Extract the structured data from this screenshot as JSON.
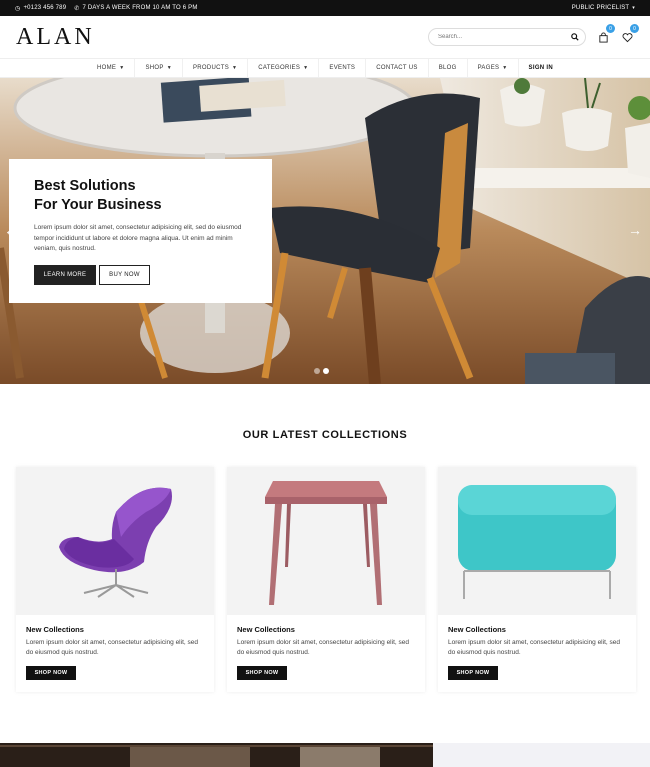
{
  "topbar": {
    "phone": "+0123 456 789",
    "hours": "7 DAYS A WEEK FROM 10 AM TO 6 PM",
    "pricelist": "PUBLIC PRICELIST"
  },
  "header": {
    "logo": "ALAN",
    "search_placeholder": "Search...",
    "cart_count": "0",
    "wishlist_count": "0"
  },
  "nav": {
    "items": [
      {
        "label": "HOME",
        "dropdown": true
      },
      {
        "label": "SHOP",
        "dropdown": true
      },
      {
        "label": "PRODUCTS",
        "dropdown": true
      },
      {
        "label": "CATEGORIES",
        "dropdown": true
      },
      {
        "label": "EVENTS",
        "dropdown": false
      },
      {
        "label": "CONTACT US",
        "dropdown": false
      },
      {
        "label": "BLOG",
        "dropdown": false
      },
      {
        "label": "PAGES",
        "dropdown": true
      },
      {
        "label": "SIGN IN",
        "dropdown": false
      }
    ]
  },
  "hero": {
    "title_line1": "Best Solutions",
    "title_line2": "For Your Business",
    "text": "Lorem ipsum dolor sit amet, consectetur adipisicing elit, sed do eiusmod tempor incididunt ut labore et dolore magna aliqua. Ut enim ad minim veniam, quis nostrud.",
    "btn_primary": "LEARN MORE",
    "btn_secondary": "BUY NOW",
    "arrow_prev": "←",
    "arrow_next": "→",
    "slides": 2,
    "active_slide": 2
  },
  "collections": {
    "title": "OUR LATEST COLLECTIONS",
    "cards": [
      {
        "image": "purple-lounge-chair",
        "title": "New Collections",
        "text": "Lorem ipsum dolor sit amet, consectetur adipisicing elit, sed do eiusmod quis nostrud.",
        "button": "SHOP NOW"
      },
      {
        "image": "pink-wooden-table",
        "title": "New Collections",
        "text": "Lorem ipsum dolor sit amet, consectetur adipisicing elit, sed do eiusmod quis nostrud.",
        "button": "SHOP NOW"
      },
      {
        "image": "teal-ottoman",
        "title": "New Collections",
        "text": "Lorem ipsum dolor sit amet, consectetur adipisicing elit, sed do eiusmod quis nostrud.",
        "button": "SHOP NOW"
      }
    ]
  },
  "colors": {
    "accent": "#3aa0e6",
    "dark": "#111111"
  }
}
